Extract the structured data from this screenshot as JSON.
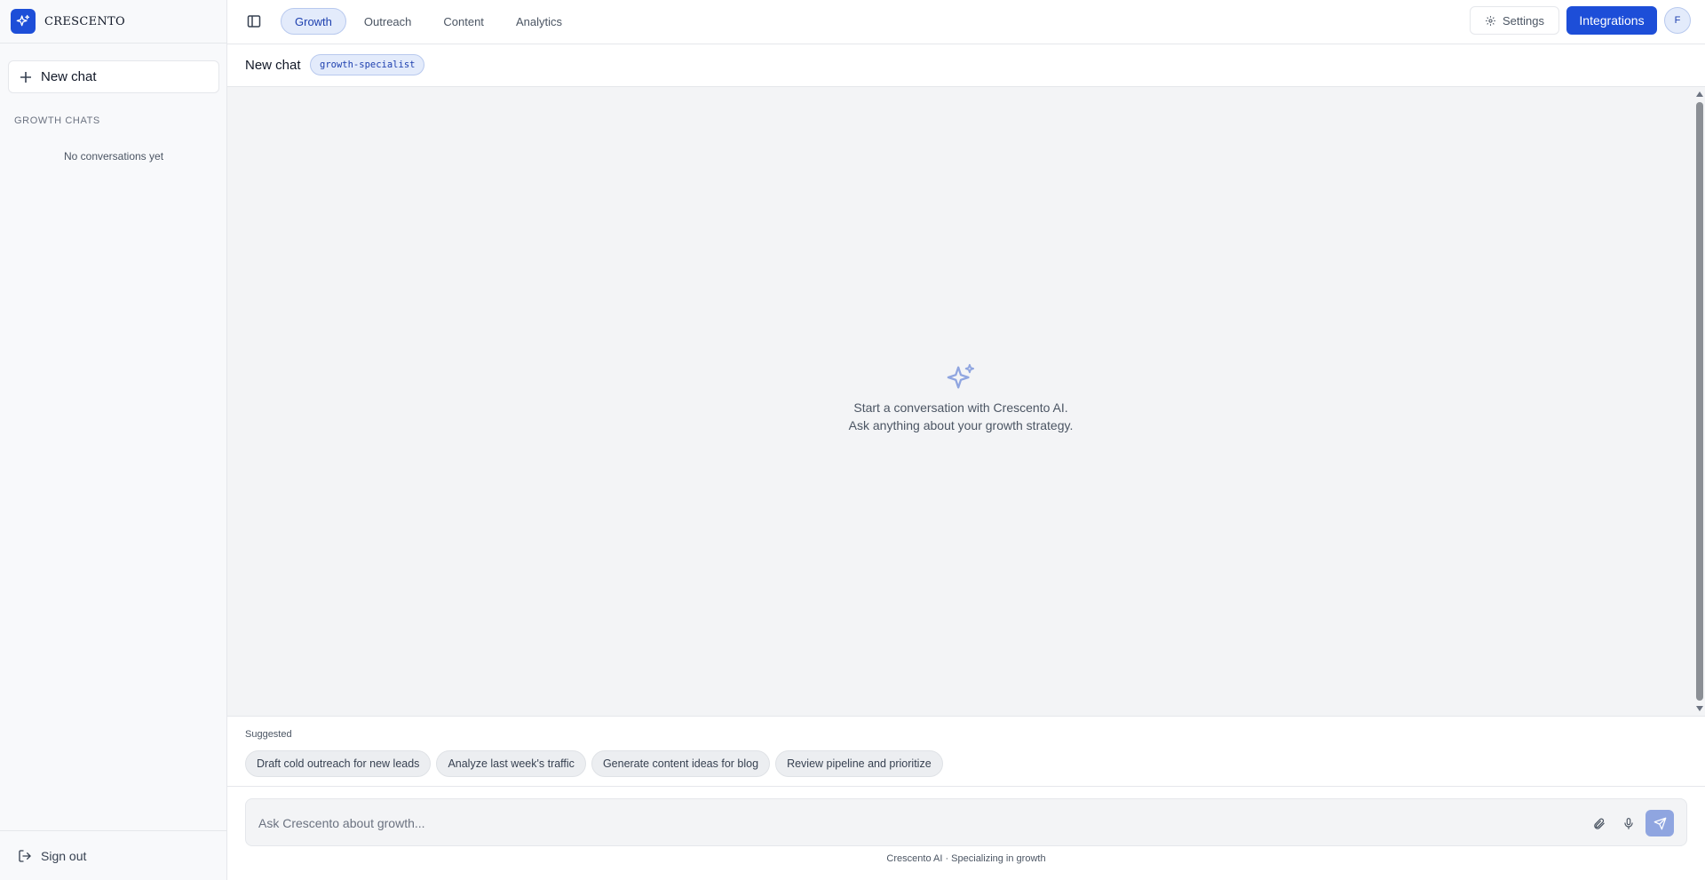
{
  "app": {
    "name": "CRESCENTO",
    "logo_icon": "sparkles-icon"
  },
  "sidebar": {
    "new_chat_label": "New chat",
    "section_label": "GROWTH CHATS",
    "empty_text": "No conversations yet",
    "signout_label": "Sign out"
  },
  "nav": {
    "tabs": [
      {
        "label": "Growth",
        "active": true
      },
      {
        "label": "Outreach",
        "active": false
      },
      {
        "label": "Content",
        "active": false
      },
      {
        "label": "Analytics",
        "active": false
      }
    ],
    "settings_label": "Settings",
    "integrations_label": "Integrations",
    "avatar_initial": "F"
  },
  "chat": {
    "title": "New chat",
    "agent_badge": "growth-specialist",
    "empty_line1": "Start a conversation with Crescento AI.",
    "empty_line2": "Ask anything about your growth strategy."
  },
  "suggestions": {
    "label": "Suggested",
    "chips": [
      "Draft cold outreach for new leads",
      "Analyze last week's traffic",
      "Generate content ideas for blog",
      "Review pipeline and prioritize"
    ]
  },
  "composer": {
    "placeholder": "Ask Crescento about growth...",
    "value": ""
  },
  "footer": {
    "text": "Crescento AI · Specializing in growth"
  },
  "colors": {
    "accent": "#1d4ed8",
    "accent_soft": "#e3ebfb",
    "send_disabled": "#8fa5e0"
  }
}
